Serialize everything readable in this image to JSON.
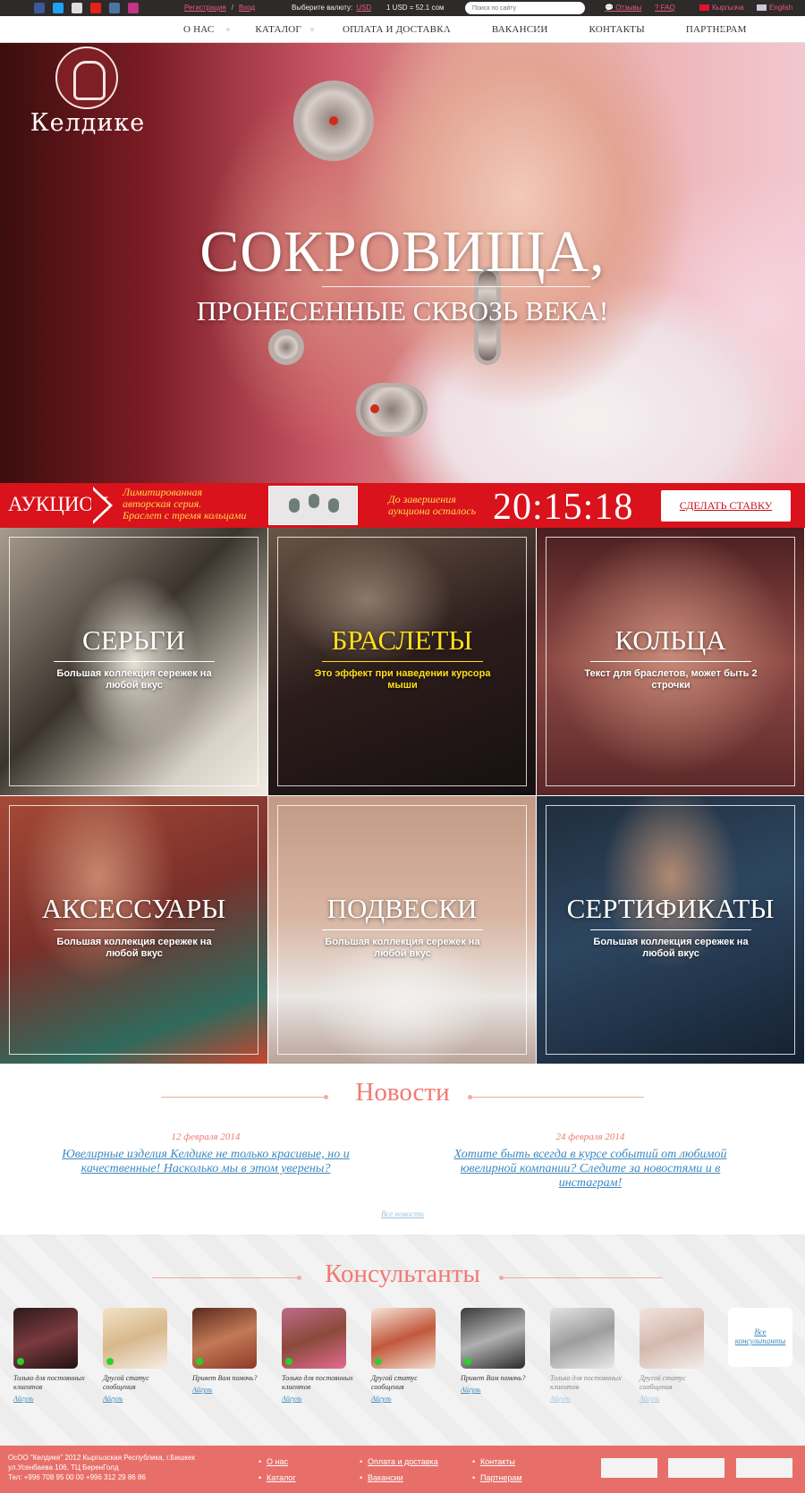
{
  "topbar": {
    "social": [
      {
        "icon": "facebook-icon",
        "color": "#3b5998"
      },
      {
        "icon": "twitter-icon",
        "color": "#1da1f2"
      },
      {
        "icon": "odnoklassniki-icon",
        "color": "#dddddd"
      },
      {
        "icon": "youtube-icon",
        "color": "#e62117"
      },
      {
        "icon": "vk-icon",
        "color": "#4c75a3"
      },
      {
        "icon": "instagram-icon",
        "color": "#c13584"
      }
    ],
    "register": "Регистрация",
    "login": "Вход",
    "currency_label": "Выберите валюту:",
    "currency": "USD",
    "rate": "1 USD = 52.1 сом",
    "search_placeholder": "Поиск по сайту",
    "reviews": "Отзывы",
    "faq": "FAQ",
    "lang_kg": "Кыргызча",
    "lang_en": "English"
  },
  "nav": [
    "О НАС",
    "КАТАЛОГ",
    "ОПЛАТА И ДОСТАВКА",
    "ВАКАНСИИ",
    "КОНТАКТЫ",
    "ПАРТНЕРАМ"
  ],
  "logo": {
    "name": "Келдике"
  },
  "hero": {
    "title": "СОКРОВИЩА,",
    "subtitle": "ПРОНЕСЕННЫЕ СКВОЗЬ ВЕКА!"
  },
  "auction": {
    "title": "АУКЦИОН",
    "lot": [
      "Лимитированная",
      "авторская серия.",
      "Браслет с тремя кольцами"
    ],
    "until": [
      "До завершения",
      "аукциона осталось"
    ],
    "timer": "20:15:18",
    "bid_button": "СДЕЛАТЬ СТАВКУ",
    "accent": "#d9121b"
  },
  "categories": [
    {
      "title": "СЕРЬГИ",
      "desc": "Большая коллекция сережек на любой вкус"
    },
    {
      "title": "БРАСЛЕТЫ",
      "desc": "Это эффект при наведении курсора мыши"
    },
    {
      "title": "КОЛЬЦА",
      "desc": "Текст для браслетов, может быть 2 строчки"
    },
    {
      "title": "АКСЕССУАРЫ",
      "desc": "Большая коллекция сережек на любой вкус"
    },
    {
      "title": "ПОДВЕСКИ",
      "desc": "Большая коллекция сережек на любой вкус"
    },
    {
      "title": "СЕРТИФИКАТЫ",
      "desc": "Большая коллекция сережек на любой вкус"
    }
  ],
  "news": {
    "title": "Новости",
    "items": [
      {
        "date": "12 февраля 2014",
        "text": "Ювелирные изделия Келдике не только красивые, но и качественные! Насколько мы в этом уверены?"
      },
      {
        "date": "24 февраля 2014",
        "text": "Хотите быть всегда в курсе событий от любимой ювелирной компании? Следите за новостями и в инстаграм!"
      }
    ],
    "all": "Все новости"
  },
  "consultants": {
    "title": "Консультанты",
    "people": [
      {
        "status": "Только для постоянных клиентов",
        "name": "Айгуль",
        "online": true
      },
      {
        "status": "Другой статус сообщения",
        "name": "Айгуль",
        "online": true
      },
      {
        "status": "Привет Вам помочь?",
        "name": "Айгуль",
        "online": true
      },
      {
        "status": "Только для постоянных клиентов",
        "name": "Айгуль",
        "online": true
      },
      {
        "status": "Другой статус сообщения",
        "name": "Айгуль",
        "online": true
      },
      {
        "status": "Привет Вам помочь?",
        "name": "Айгуль",
        "online": true
      },
      {
        "status": "Только для постоянных клиентов",
        "name": "Айгуль",
        "online": false
      },
      {
        "status": "Другой статус сообщения",
        "name": "Айгуль",
        "online": false
      }
    ],
    "all": "Все консультанты"
  },
  "footer": {
    "address": [
      "ОсОО \"Келдике\" 2012 Кыргызская Республика, г.Бишкек",
      "ул.Усенбаева 106, ТЦ БеренГолд",
      "Тел:  +996 708 95 00 00   +996 312 29 86 86"
    ],
    "links": [
      "О нас",
      "Каталог",
      "Оплата и доставка",
      "Вакансии",
      "Контакты",
      "Партнерам"
    ]
  }
}
